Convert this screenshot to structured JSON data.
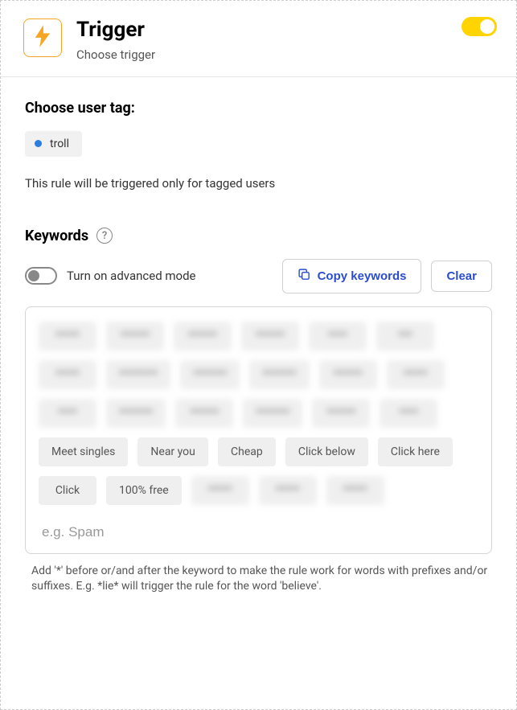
{
  "header": {
    "title": "Trigger",
    "subtitle": "Choose trigger",
    "icon": "lightning-icon",
    "enabled": true
  },
  "tag_section": {
    "label": "Choose user tag:",
    "tags": [
      {
        "label": "troll",
        "color": "#2a7de1"
      }
    ],
    "note": "This rule will be triggered only for tagged users"
  },
  "keywords": {
    "title": "Keywords",
    "advanced_mode": {
      "label": "Turn on advanced mode",
      "on": false
    },
    "copy_label": "Copy keywords",
    "clear_label": "Clear",
    "input_placeholder": "e.g. Spam",
    "chips": [
      {
        "text": "*****",
        "blurred": true
      },
      {
        "text": "******",
        "blurred": true
      },
      {
        "text": "******",
        "blurred": true
      },
      {
        "text": "******",
        "blurred": true
      },
      {
        "text": "****",
        "blurred": true
      },
      {
        "text": "***",
        "blurred": true
      },
      {
        "text": "*****",
        "blurred": true
      },
      {
        "text": "********",
        "blurred": true
      },
      {
        "text": "*******",
        "blurred": true
      },
      {
        "text": "*******",
        "blurred": true
      },
      {
        "text": "******",
        "blurred": true
      },
      {
        "text": "*****",
        "blurred": true
      },
      {
        "text": "****",
        "blurred": true
      },
      {
        "text": "*******",
        "blurred": true
      },
      {
        "text": "******",
        "blurred": true
      },
      {
        "text": "*******",
        "blurred": true
      },
      {
        "text": "******",
        "blurred": true
      },
      {
        "text": "****",
        "blurred": true
      },
      {
        "text": "Meet singles",
        "blurred": false
      },
      {
        "text": "Near you",
        "blurred": false
      },
      {
        "text": "Cheap",
        "blurred": false
      },
      {
        "text": "Click below",
        "blurred": false
      },
      {
        "text": "Click here",
        "blurred": false
      },
      {
        "text": "Click",
        "blurred": false
      },
      {
        "text": "100% free",
        "blurred": false
      },
      {
        "text": "*****",
        "blurred": true
      },
      {
        "text": "*****",
        "blurred": true
      },
      {
        "text": "*****",
        "blurred": true
      }
    ],
    "hint": "Add '*' before or/and after the keyword to make the rule work for words with prefixes and/or suffixes. E.g. *lie* will trigger the rule for the word 'believe'."
  }
}
